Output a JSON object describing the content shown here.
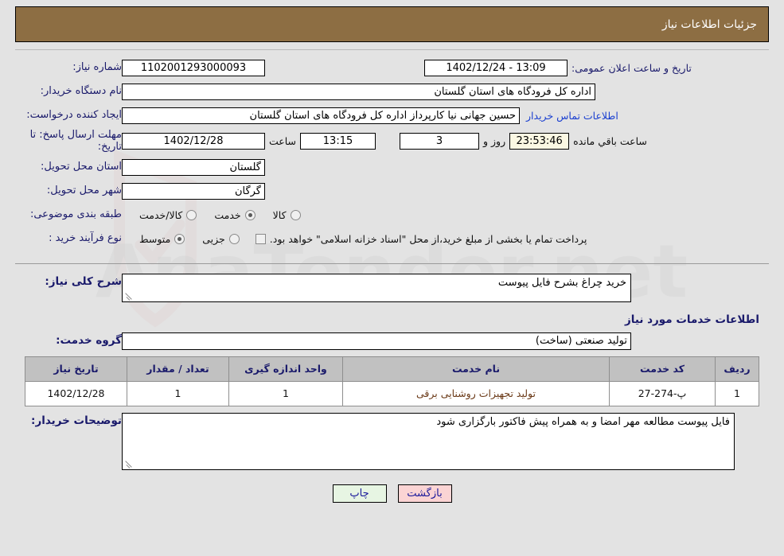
{
  "header": {
    "title": "جزئیات اطلاعات نیاز"
  },
  "form": {
    "need_number": {
      "label": "شماره نیاز:",
      "value": "1102001293000093"
    },
    "public_announce": {
      "label": "تاریخ و ساعت اعلان عمومی:",
      "value": "13:09 - 1402/12/24"
    },
    "buyer_org": {
      "label": "نام دستگاه خریدار:",
      "value": "اداره کل فرودگاه های استان گلستان"
    },
    "creator": {
      "label": "ایجاد کننده درخواست:",
      "value": "حسین  جهانی نیا کارپرداز اداره کل فرودگاه های استان گلستان"
    },
    "buyer_contact_link": "اطلاعات تماس خریدار",
    "deadline": {
      "label": "مهلت ارسال پاسخ: تا تاریخ:",
      "date": "1402/12/28",
      "hour_label": "ساعت",
      "time": "13:15",
      "days": "3",
      "days_unit": "روز و",
      "countdown": "23:53:46",
      "countdown_suffix": "ساعت باقي مانده"
    },
    "province": {
      "label": "استان محل تحویل:",
      "value": "گلستان"
    },
    "city": {
      "label": "شهر محل تحویل:",
      "value": "گرگان"
    },
    "category": {
      "label": "طبقه بندی موضوعی:",
      "options": [
        "کالا",
        "خدمت",
        "کالا/خدمت"
      ],
      "selected": "خدمت"
    },
    "purchase_type": {
      "label": "نوع فرآیند خرید :",
      "options": [
        "جزیی",
        "متوسط"
      ],
      "selected": "متوسط",
      "treasury_checkbox_label": "پرداخت تمام یا بخشی از مبلغ خرید،از محل \"اسناد خزانه اسلامی\" خواهد بود.",
      "treasury_checked": false
    }
  },
  "description": {
    "label": "شرح کلی نیاز:",
    "value": "خرید چراغ بشرح فایل پیوست"
  },
  "services_section": {
    "heading": "اطلاعات خدمات مورد نیاز",
    "group_label": "گروه خدمت:",
    "group_value": "تولید صنعتی (ساخت)",
    "table": {
      "columns": [
        "ردیف",
        "کد خدمت",
        "نام خدمت",
        "واحد اندازه گیری",
        "تعداد / مقدار",
        "تاریخ نیاز"
      ],
      "rows": [
        {
          "row_no": "1",
          "service_code": "پ-274-27",
          "service_name": "تولید تجهیزات روشنایی برقی",
          "unit": "1",
          "quantity": "1",
          "need_date": "1402/12/28"
        }
      ]
    }
  },
  "buyer_notes": {
    "label": "توضیحات خریدار:",
    "value": "فایل پیوست مطالعه مهر امضا و به همراه پیش فاکتور بارگزاری شود"
  },
  "footer": {
    "print_label": "چاپ",
    "back_label": "بازگشت"
  },
  "watermark": {
    "text": "AnaTender.net"
  },
  "colors": {
    "header_bar": "#8d6e43",
    "page_background": "#e3e3e3",
    "label_blue": "#1a1a6b",
    "link_blue": "#1a3fd0",
    "table_header": "#c1c1c1",
    "print_button": "#e7f5e3",
    "back_button": "#fbd4d4",
    "countdown_field": "#fbf8e3"
  }
}
